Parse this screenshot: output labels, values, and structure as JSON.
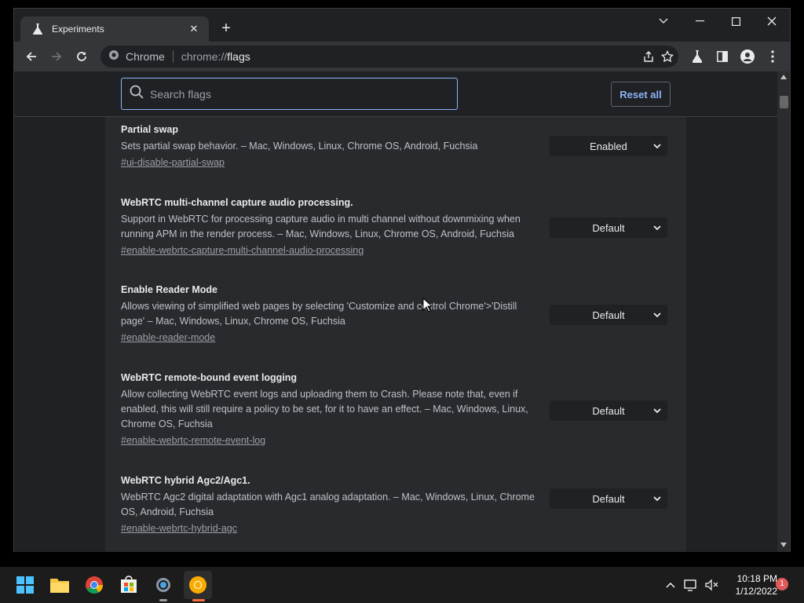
{
  "browser": {
    "tab": {
      "title": "Experiments"
    },
    "address": {
      "site_label": "Chrome",
      "scheme": "chrome://",
      "path": "flags"
    }
  },
  "flags_page": {
    "search": {
      "placeholder": "Search flags"
    },
    "reset_label": "Reset all",
    "flags": [
      {
        "title": "Partial swap",
        "description": "Sets partial swap behavior. – Mac, Windows, Linux, Chrome OS, Android, Fuchsia",
        "link": "#ui-disable-partial-swap",
        "value": "Enabled"
      },
      {
        "title": "WebRTC multi-channel capture audio processing.",
        "description": "Support in WebRTC for processing capture audio in multi channel without downmixing when running APM in the render process. – Mac, Windows, Linux, Chrome OS, Android, Fuchsia",
        "link": "#enable-webrtc-capture-multi-channel-audio-processing",
        "value": "Default"
      },
      {
        "title": "Enable Reader Mode",
        "description": "Allows viewing of simplified web pages by selecting 'Customize and control Chrome'>'Distill page' – Mac, Windows, Linux, Chrome OS, Fuchsia",
        "link": "#enable-reader-mode",
        "value": "Default"
      },
      {
        "title": "WebRTC remote-bound event logging",
        "description": "Allow collecting WebRTC event logs and uploading them to Crash. Please note that, even if enabled, this will still require a policy to be set, for it to have an effect. – Mac, Windows, Linux, Chrome OS, Fuchsia",
        "link": "#enable-webrtc-remote-event-log",
        "value": "Default"
      },
      {
        "title": "WebRTC hybrid Agc2/Agc1.",
        "description": "WebRTC Agc2 digital adaptation with Agc1 analog adaptation. – Mac, Windows, Linux, Chrome OS, Android, Fuchsia",
        "link": "#enable-webrtc-hybrid-agc",
        "value": "Default"
      }
    ]
  },
  "taskbar": {
    "apps": [
      "start-icon",
      "file-explorer-icon",
      "chrome-icon",
      "store-icon",
      "settings-icon",
      "chrome-canary-icon"
    ],
    "clock": {
      "time": "10:18 PM",
      "date": "1/12/2022"
    },
    "notification_count": "1"
  },
  "colors": {
    "accent": "#8ab4f8",
    "background": "#202124",
    "panel": "#292a2d"
  }
}
